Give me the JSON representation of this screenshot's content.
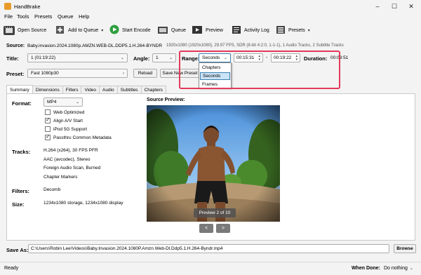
{
  "app": {
    "title": "HandBrake"
  },
  "menu": [
    "File",
    "Tools",
    "Presets",
    "Queue",
    "Help"
  ],
  "toolbar": {
    "open_source": "Open Source",
    "add_to_queue": "Add to Queue",
    "start_encode": "Start Encode",
    "queue": "Queue",
    "preview": "Preview",
    "activity_log": "Activity Log",
    "presets": "Presets"
  },
  "source": {
    "label": "Source:",
    "name": "Baby.invasion.2024.1080p.AMZN.WEB-DL.DDP5.1.H.264-BYNDR",
    "details": "1920x1080 (1920x1080), 29.97 FPS, SDR (8-bit 4:2:0, 1-1-1), 1 Audio Tracks, 2 Subtitle Tracks"
  },
  "title_row": {
    "title_label": "Title:",
    "title_value": "1 (01:19:22)",
    "angle_label": "Angle:",
    "angle_value": "1",
    "range_label": "Range:",
    "range_value": "Seconds",
    "range_start": "00:15:31",
    "range_sep": "-",
    "range_end": "00:19:22",
    "duration_label": "Duration:",
    "duration_value": "00:03:51"
  },
  "range_options": [
    "Chapters",
    "Seconds",
    "Frames"
  ],
  "preset_row": {
    "label": "Preset:",
    "value": "Fast 1080p30",
    "reload": "Reload",
    "save_new": "Save New Preset"
  },
  "tabs": [
    "Summary",
    "Dimensions",
    "Filters",
    "Video",
    "Audio",
    "Subtitles",
    "Chapters"
  ],
  "summary": {
    "format_label": "Format:",
    "format_value": "MP4",
    "options": [
      {
        "label": "Web Optimized",
        "checked": false
      },
      {
        "label": "Align A/V Start",
        "checked": true
      },
      {
        "label": "iPod 5G Support",
        "checked": false
      },
      {
        "label": "Passthru Common Metadata",
        "checked": true
      }
    ],
    "tracks_label": "Tracks:",
    "tracks": [
      "H.264 (x264), 30 FPS PFR",
      "AAC (avcodec), Stereo",
      "Foreign Audio Scan, Burned",
      "Chapter Markers"
    ],
    "filters_label": "Filters:",
    "filters_value": "Decomb",
    "size_label": "Size:",
    "size_value": "1234x1080 storage, 1234x1080 display",
    "source_preview_label": "Source Preview:",
    "preview_badge": "Preview 2 of 10",
    "prev": "<",
    "next": ">"
  },
  "save": {
    "label": "Save As:",
    "path": "C:\\Users\\Robin Lee\\Videos\\Baby.Invasion.2024.1080P.Amzn.Web-Dl.Ddp5.1.H.264-Byndr.mp4",
    "browse": "Browse"
  },
  "status": {
    "text": "Ready",
    "when_done_label": "When Done:",
    "when_done_value": "Do nothing"
  },
  "colors": {
    "highlight": "#e23a5a"
  }
}
